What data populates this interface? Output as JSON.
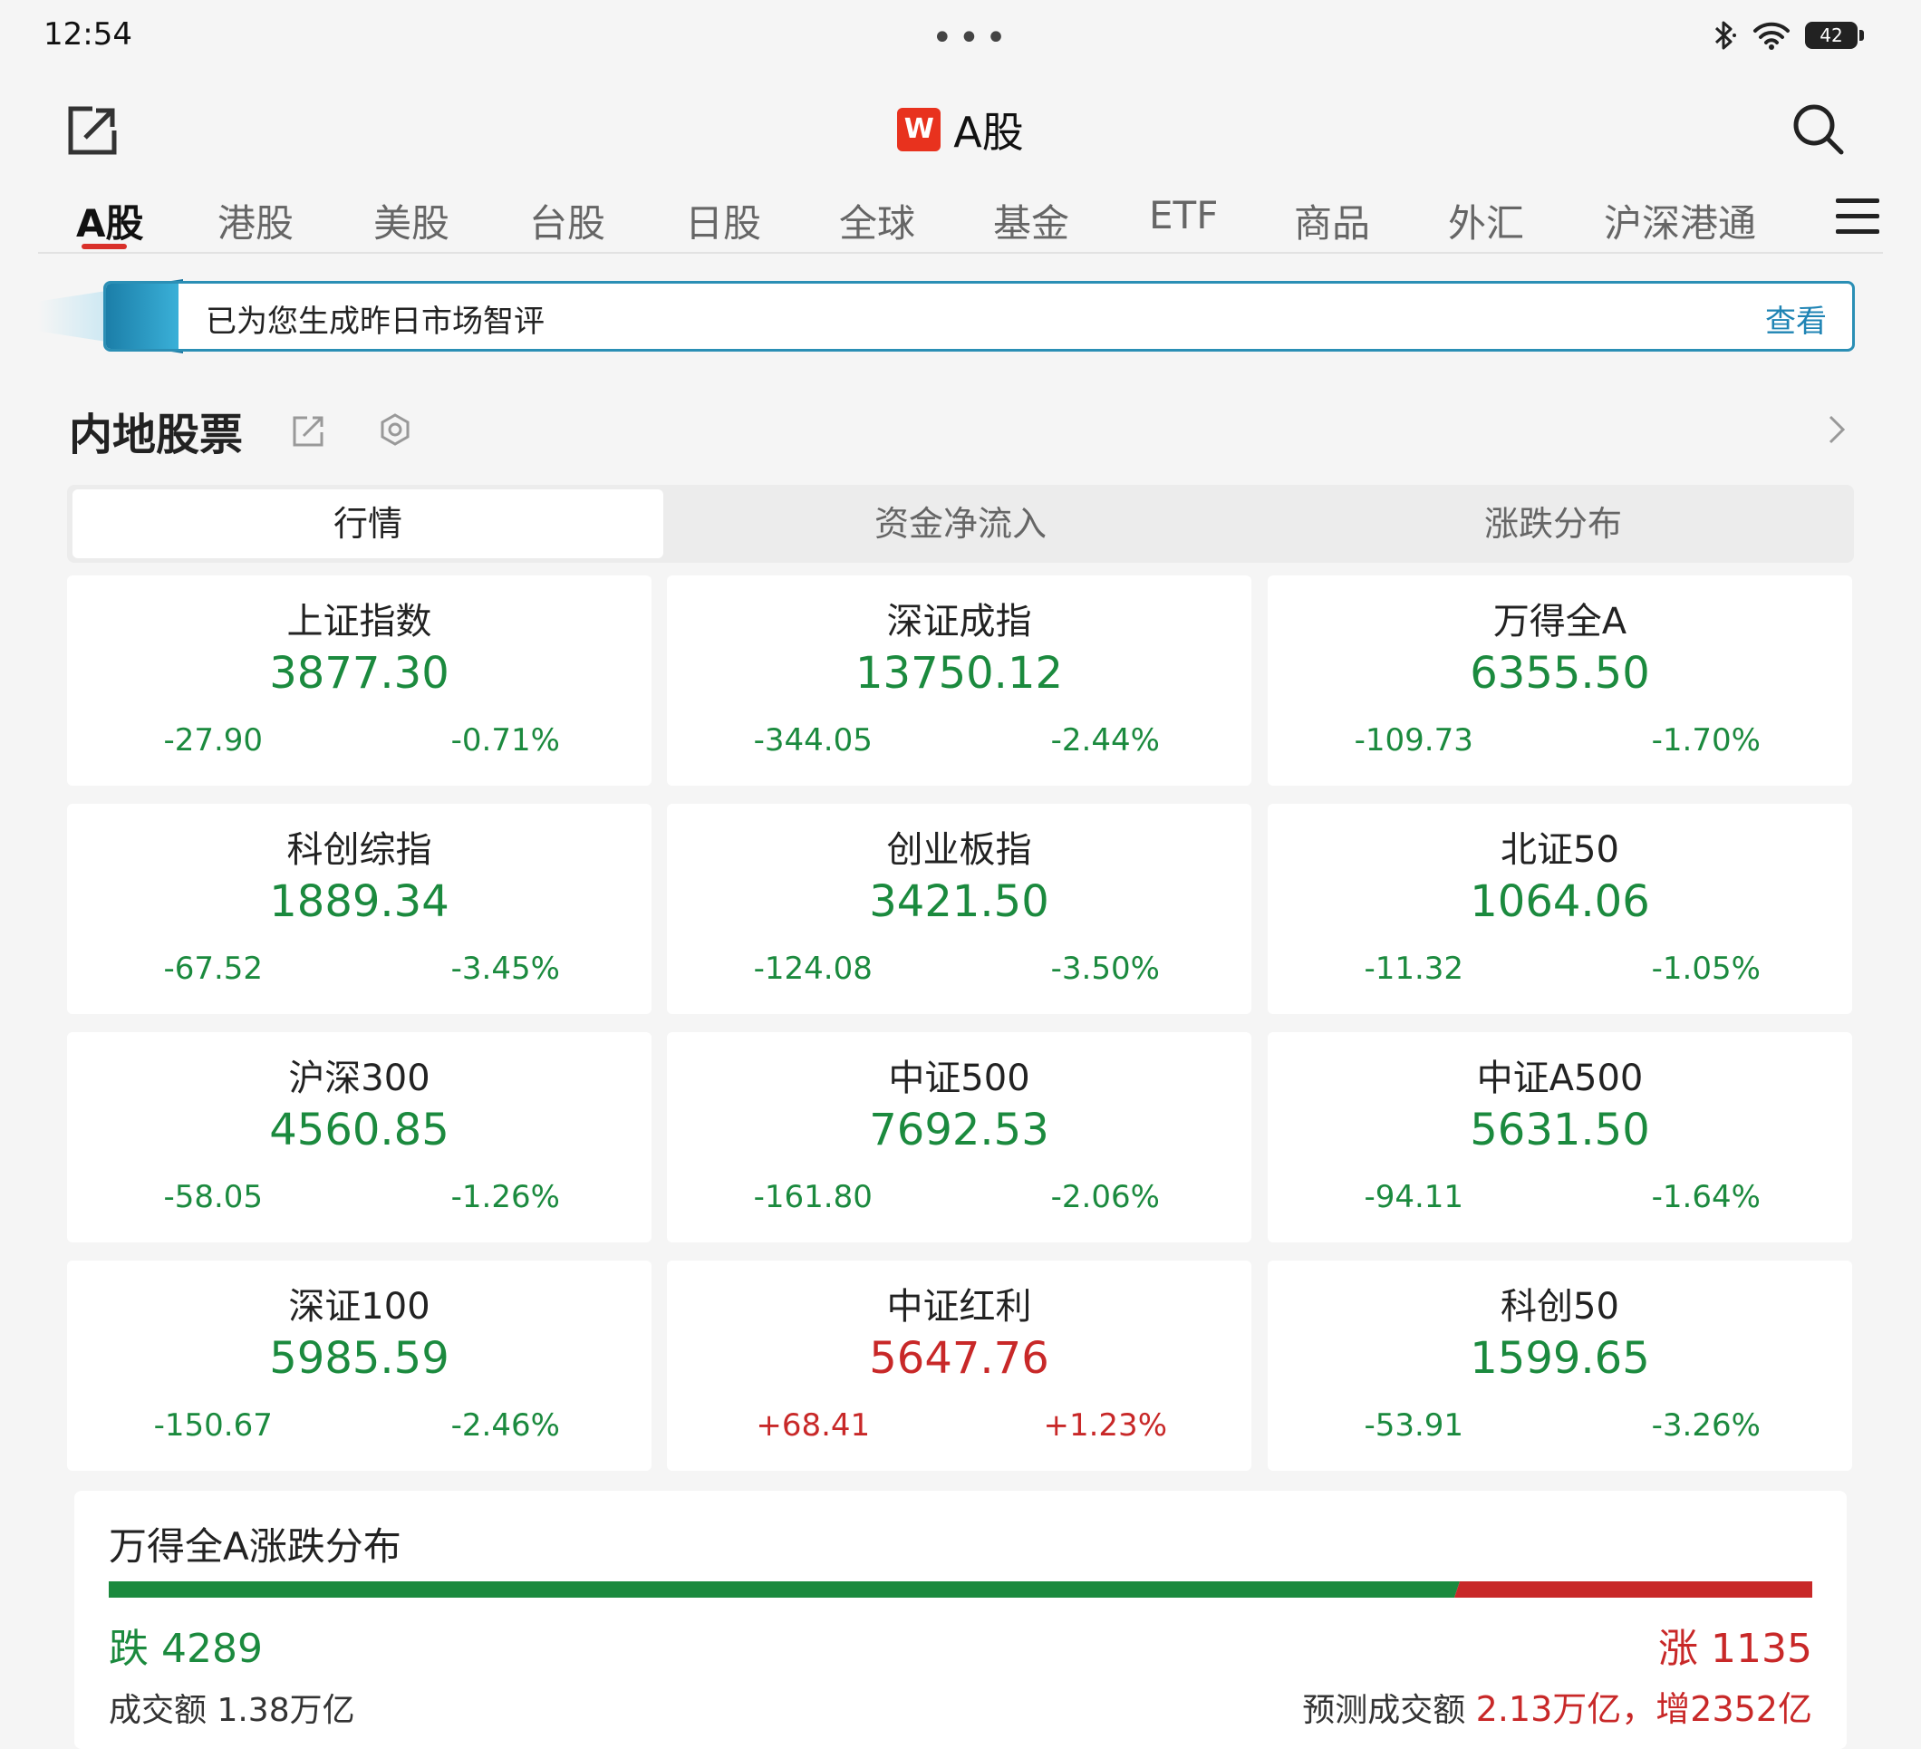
{
  "status": {
    "time": "12:54",
    "battery": "42"
  },
  "header": {
    "logo": "W",
    "title": "A股"
  },
  "tabs": [
    "A股",
    "港股",
    "美股",
    "台股",
    "日股",
    "全球",
    "基金",
    "ETF",
    "商品",
    "外汇",
    "沪深港通"
  ],
  "banner": {
    "text": "已为您生成昨日市场智评",
    "link": "查看"
  },
  "section": {
    "title": "内地股票"
  },
  "segments": [
    "行情",
    "资金净流入",
    "涨跌分布"
  ],
  "indices": [
    {
      "name": "上证指数",
      "value": "3877.30",
      "change": "-27.90",
      "pct": "-0.71%",
      "direction": "down"
    },
    {
      "name": "深证成指",
      "value": "13750.12",
      "change": "-344.05",
      "pct": "-2.44%",
      "direction": "down"
    },
    {
      "name": "万得全A",
      "value": "6355.50",
      "change": "-109.73",
      "pct": "-1.70%",
      "direction": "down"
    },
    {
      "name": "科创综指",
      "value": "1889.34",
      "change": "-67.52",
      "pct": "-3.45%",
      "direction": "down"
    },
    {
      "name": "创业板指",
      "value": "3421.50",
      "change": "-124.08",
      "pct": "-3.50%",
      "direction": "down"
    },
    {
      "name": "北证50",
      "value": "1064.06",
      "change": "-11.32",
      "pct": "-1.05%",
      "direction": "down"
    },
    {
      "name": "沪深300",
      "value": "4560.85",
      "change": "-58.05",
      "pct": "-1.26%",
      "direction": "down"
    },
    {
      "name": "中证500",
      "value": "7692.53",
      "change": "-161.80",
      "pct": "-2.06%",
      "direction": "down"
    },
    {
      "name": "中证A500",
      "value": "5631.50",
      "change": "-94.11",
      "pct": "-1.64%",
      "direction": "down"
    },
    {
      "name": "深证100",
      "value": "5985.59",
      "change": "-150.67",
      "pct": "-2.46%",
      "direction": "down"
    },
    {
      "name": "中证红利",
      "value": "5647.76",
      "change": "+68.41",
      "pct": "+1.23%",
      "direction": "up"
    },
    {
      "name": "科创50",
      "value": "1599.65",
      "change": "-53.91",
      "pct": "-3.26%",
      "direction": "down"
    }
  ],
  "distribution": {
    "title": "万得全A涨跌分布",
    "down_label": "跌 4289",
    "up_label": "涨 1135",
    "down_count": 4289,
    "up_count": 1135,
    "turnover": "成交额 1.38万亿",
    "forecast_label": "预测成交额",
    "forecast_value": "2.13万亿，增2352亿"
  },
  "colors": {
    "up": "#c82828",
    "down": "#1b8a3e",
    "accent": "#d9302a",
    "banner_border": "#2b8fb5"
  }
}
